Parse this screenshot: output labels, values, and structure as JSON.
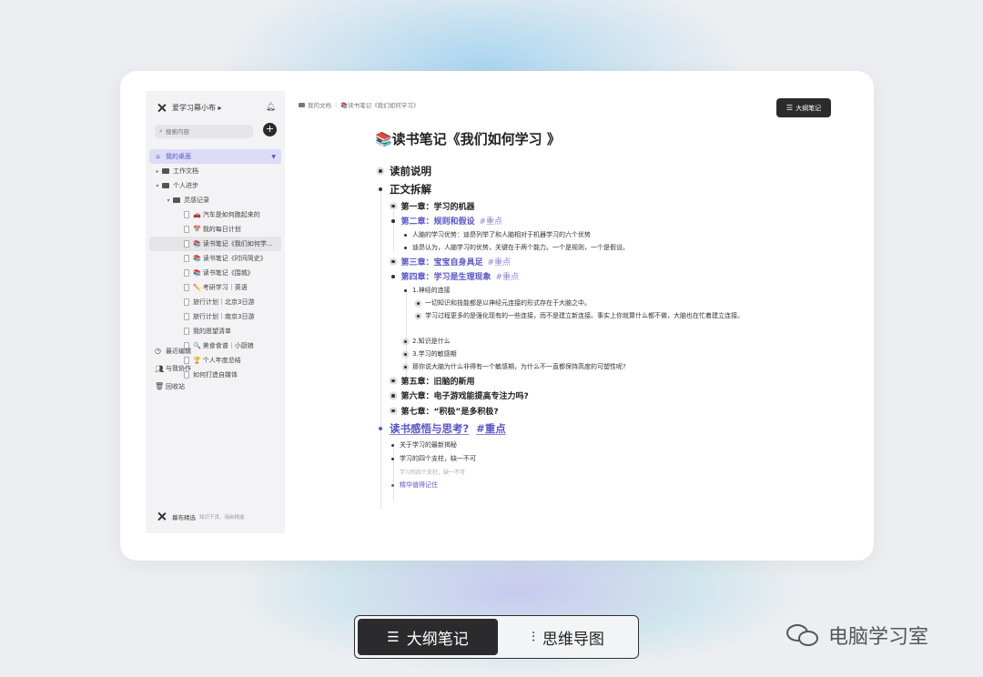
{
  "sidebar": {
    "workspace_name": "爱学习幕小布 ▸",
    "search_placeholder": "搜索内容",
    "add_label": "+",
    "tree": [
      {
        "label": "我的桌面",
        "state": "active"
      },
      {
        "label": "工作文档"
      },
      {
        "label": "个人进步"
      },
      {
        "label": "灵感记录"
      },
      {
        "emoji": "🚗",
        "label": "汽车是如何跑起来的"
      },
      {
        "emoji": "📅",
        "label": "我的每日计划"
      },
      {
        "emoji": "📚",
        "label": "读书笔记《我们如何学...",
        "state": "selected"
      },
      {
        "emoji": "📚",
        "label": "读书笔记《时间简史》"
      },
      {
        "emoji": "📚",
        "label": "读书笔记《围城》"
      },
      {
        "emoji": "✏️",
        "label": "考研学习｜英语"
      },
      {
        "label": "旅行计划｜北京3日游"
      },
      {
        "label": "旅行计划｜南京3日游"
      },
      {
        "label": "我的愿望清单"
      },
      {
        "emoji": "🔍",
        "label": "美食食谱｜小厨娘"
      },
      {
        "emoji": "🏆",
        "label": "个人年度总结"
      },
      {
        "label": "如何打造自媒体"
      }
    ],
    "nav": [
      {
        "label": "最近编辑"
      },
      {
        "label": "与我协作"
      },
      {
        "label": "回收站"
      }
    ],
    "footer": {
      "brand": "幕布精选",
      "slogan": "知识干货、用启精选"
    }
  },
  "breadcrumb": {
    "root": "我的文档",
    "current": "📚读书笔记《我们如何学习》"
  },
  "outline_button_label": "大纲笔记",
  "doc": {
    "title": "📚读书笔记《我们如何学习 》",
    "s1": "读前说明",
    "s2": "正文拆解",
    "c1": "第一章：学习的机器",
    "c2": "第二章：规则和假设",
    "c2_tag": "#重点",
    "c2_a": "人脑的学习优势：迪昂列举了和人脑相对于机器学习的六个优势",
    "c2_b": "迪昂认为，人脑学习的优势，关键在于两个能力。一个是规则，一个是假设。",
    "c3": "第三章：宝宝自身具足",
    "c3_tag": "#重点",
    "c4": "第四章：学习是生理现象",
    "c4_tag": "#重点",
    "c4_1": "1.神经的连接",
    "c4_1a": "一切知识和技能都是以神经元连接的形式存在于大脑之中。",
    "c4_1b": "学习过程更多的是强化现有的一些连接，而不是建立新连接。事实上你就算什么都不做，大脑也在忙着建立连接。",
    "c4_2": "2.知识是什么",
    "c4_3": "3.学习的敏感期",
    "c4_4": "那你说大脑为什么非得有一个敏感期，为什么不一直都保持高度的可塑性呢?",
    "c5": "第五章：旧脑的新用",
    "c6": "第六章：电子游戏能提高专注力吗?",
    "c7": "第七章：“积极”是多积极?",
    "s3": "读书感悟与思考?",
    "s3_tag": "#重点",
    "s3_a": "关于学习的最新揭秘",
    "s3_b": "学习的四个支柱，缺一不可",
    "s3_b_note": "学习的四个支柱，缺一不可",
    "s3_c": "精华值得记住"
  },
  "toggle": {
    "outline": "大纲笔记",
    "mindmap": "思维导图"
  },
  "brand_label": "电脑学习室",
  "colors": {
    "accent": "#5a55c8",
    "dark": "#2b2b2b",
    "sidebar_bg": "#f3f3f5"
  }
}
